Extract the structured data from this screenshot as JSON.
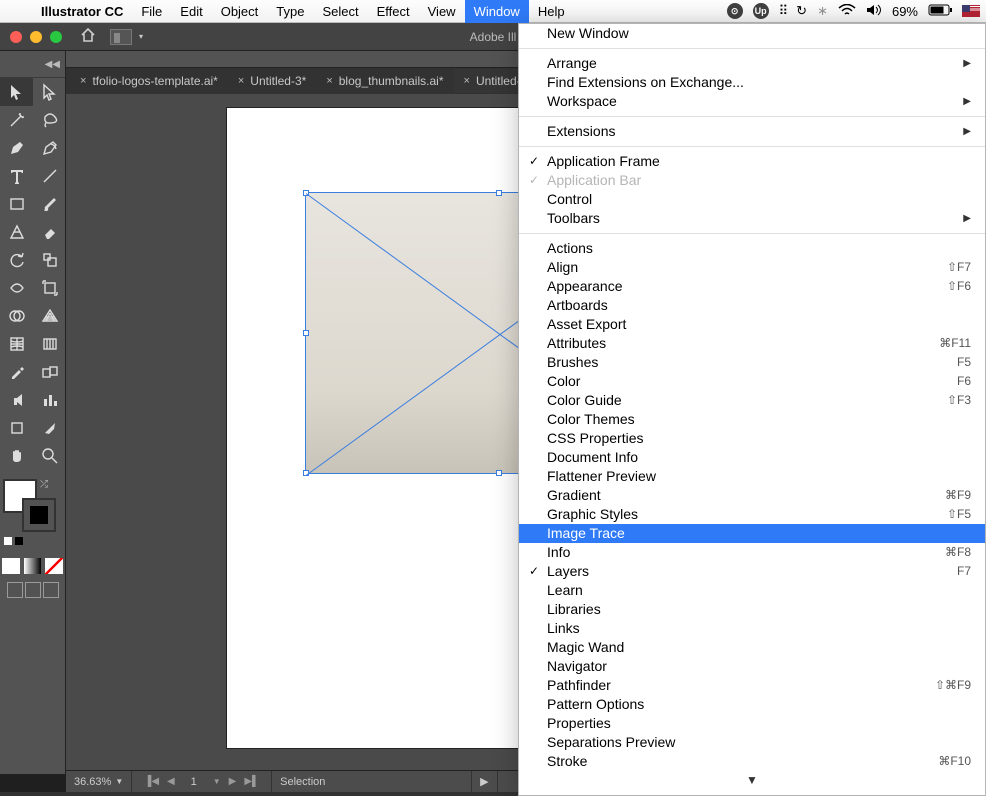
{
  "mac_menu": {
    "app": "Illustrator CC",
    "items": [
      "File",
      "Edit",
      "Object",
      "Type",
      "Select",
      "Effect",
      "View",
      "Window",
      "Help"
    ],
    "active": "Window",
    "battery": "69%"
  },
  "titlebar": {
    "title": "Adobe Ill"
  },
  "tabs": [
    {
      "label": "tfolio-logos-template.ai*",
      "active": false
    },
    {
      "label": "Untitled-3*",
      "active": false
    },
    {
      "label": "blog_thumbnails.ai*",
      "active": false
    },
    {
      "label": "Untitled-",
      "active": true
    }
  ],
  "status": {
    "zoom": "36.63%",
    "artboard": "1",
    "tool": "Selection"
  },
  "window_menu": {
    "groups": [
      [
        {
          "label": "New Window"
        }
      ],
      [
        {
          "label": "Arrange",
          "sub": true
        },
        {
          "label": "Find Extensions on Exchange..."
        },
        {
          "label": "Workspace",
          "sub": true
        }
      ],
      [
        {
          "label": "Extensions",
          "sub": true
        }
      ],
      [
        {
          "label": "Application Frame",
          "check": true
        },
        {
          "label": "Application Bar",
          "check": true,
          "disabled": true
        },
        {
          "label": "Control"
        },
        {
          "label": "Toolbars",
          "sub": true
        }
      ],
      [
        {
          "label": "Actions"
        },
        {
          "label": "Align",
          "shortcut": "⇧F7"
        },
        {
          "label": "Appearance",
          "shortcut": "⇧F6"
        },
        {
          "label": "Artboards"
        },
        {
          "label": "Asset Export"
        },
        {
          "label": "Attributes",
          "shortcut": "⌘F11"
        },
        {
          "label": "Brushes",
          "shortcut": "F5"
        },
        {
          "label": "Color",
          "shortcut": "F6"
        },
        {
          "label": "Color Guide",
          "shortcut": "⇧F3"
        },
        {
          "label": "Color Themes"
        },
        {
          "label": "CSS Properties"
        },
        {
          "label": "Document Info"
        },
        {
          "label": "Flattener Preview"
        },
        {
          "label": "Gradient",
          "shortcut": "⌘F9"
        },
        {
          "label": "Graphic Styles",
          "shortcut": "⇧F5"
        },
        {
          "label": "Image Trace",
          "highlight": true
        },
        {
          "label": "Info",
          "shortcut": "⌘F8"
        },
        {
          "label": "Layers",
          "check": true,
          "shortcut": "F7"
        },
        {
          "label": "Learn"
        },
        {
          "label": "Libraries"
        },
        {
          "label": "Links"
        },
        {
          "label": "Magic Wand"
        },
        {
          "label": "Navigator"
        },
        {
          "label": "Pathfinder",
          "shortcut": "⇧⌘F9"
        },
        {
          "label": "Pattern Options"
        },
        {
          "label": "Properties"
        },
        {
          "label": "Separations Preview"
        },
        {
          "label": "Stroke",
          "shortcut": "⌘F10"
        }
      ]
    ],
    "more": "▼"
  }
}
